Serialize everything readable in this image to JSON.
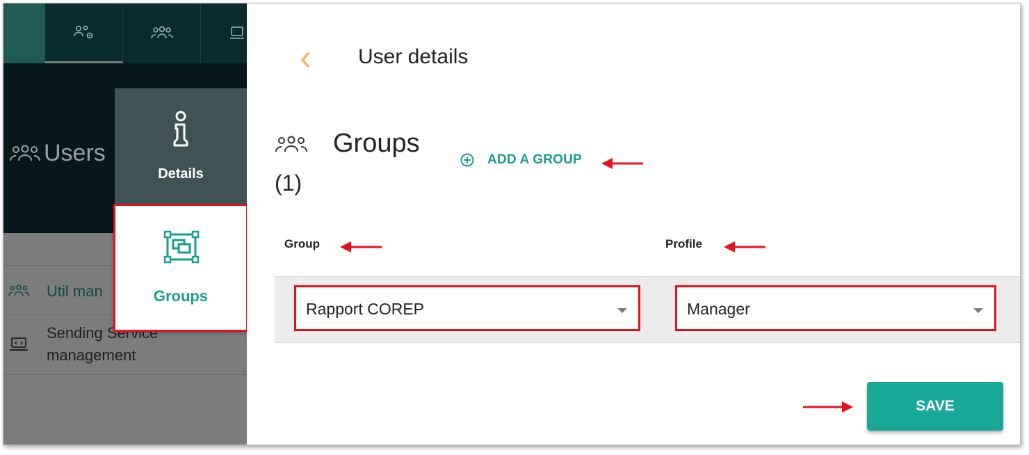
{
  "nav": {
    "tabs": [
      {
        "icon": "users-gear-icon"
      },
      {
        "icon": "users-icon"
      },
      {
        "icon": "device-icon"
      }
    ]
  },
  "users_header": {
    "title": "Users",
    "icon": "users-icon"
  },
  "user_list": {
    "items": [
      {
        "label": "Util man",
        "icon": "users-icon"
      },
      {
        "label": "Sending Service management",
        "icon": "laptop-icon"
      }
    ]
  },
  "side_menu": {
    "details_label": "Details",
    "groups_label": "Groups"
  },
  "panel": {
    "title": "User details",
    "back_icon": "chevron-left-icon",
    "groups_title": "Groups",
    "groups_count": "(1)",
    "add_group_label": "ADD A GROUP",
    "column_headers": {
      "group": "Group",
      "profile": "Profile"
    },
    "group_value": "Rapport COREP",
    "profile_value": "Manager",
    "save_label": "SAVE"
  },
  "colors": {
    "accent": "#1aa896",
    "highlight": "#e8111b",
    "back_chevron": "#f5b062",
    "dark_header": "#0a2a2f"
  }
}
